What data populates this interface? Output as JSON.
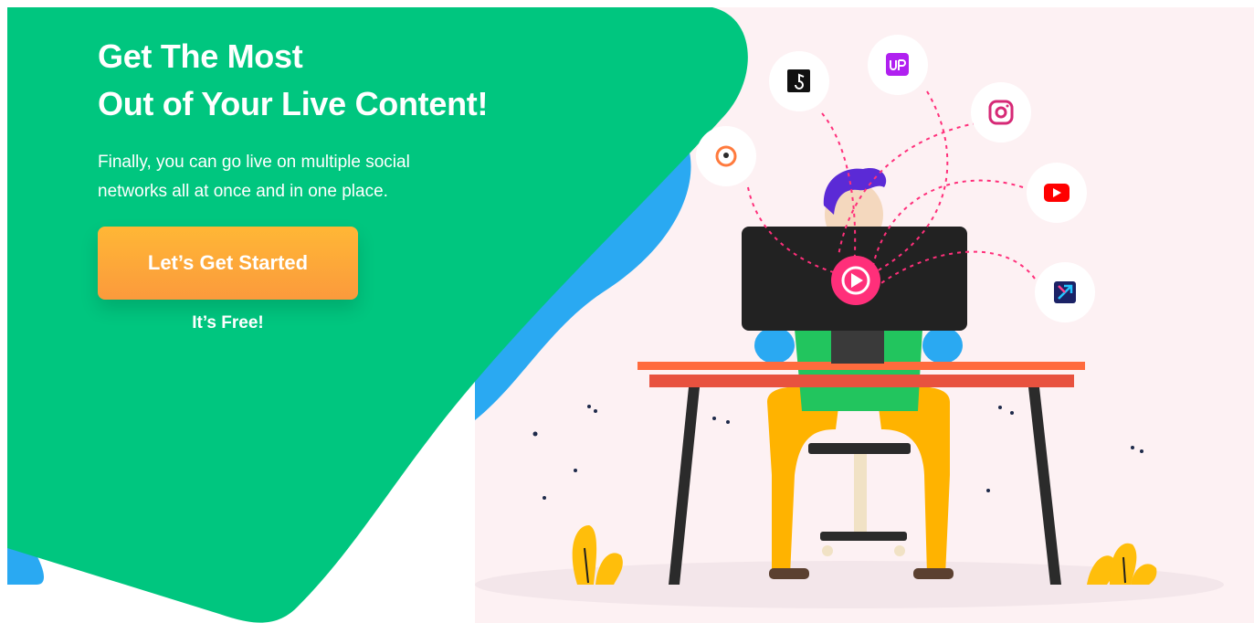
{
  "hero": {
    "title_line1": "Get The Most",
    "title_line2": "Out of Your Live Content!",
    "subtitle_line1": "Finally, you can go live on multiple social",
    "subtitle_line2": "networks all at once and in one place.",
    "cta_label": "Let’s Get Started",
    "cta_note": "It’s Free!"
  },
  "illustration": {
    "platform_icons": [
      "periscope-icon",
      "tiktok-icon",
      "upstream-icon",
      "instagram-icon",
      "youtube-icon",
      "mixer-icon"
    ],
    "center_icon": "play-icon"
  },
  "colors": {
    "green_panel": "#00c67f",
    "blue_accent": "#2aa9f2",
    "cta_orange": "#fba43a",
    "play_pink": "#ff2f7a",
    "pink_background": "#fdf1f3"
  }
}
